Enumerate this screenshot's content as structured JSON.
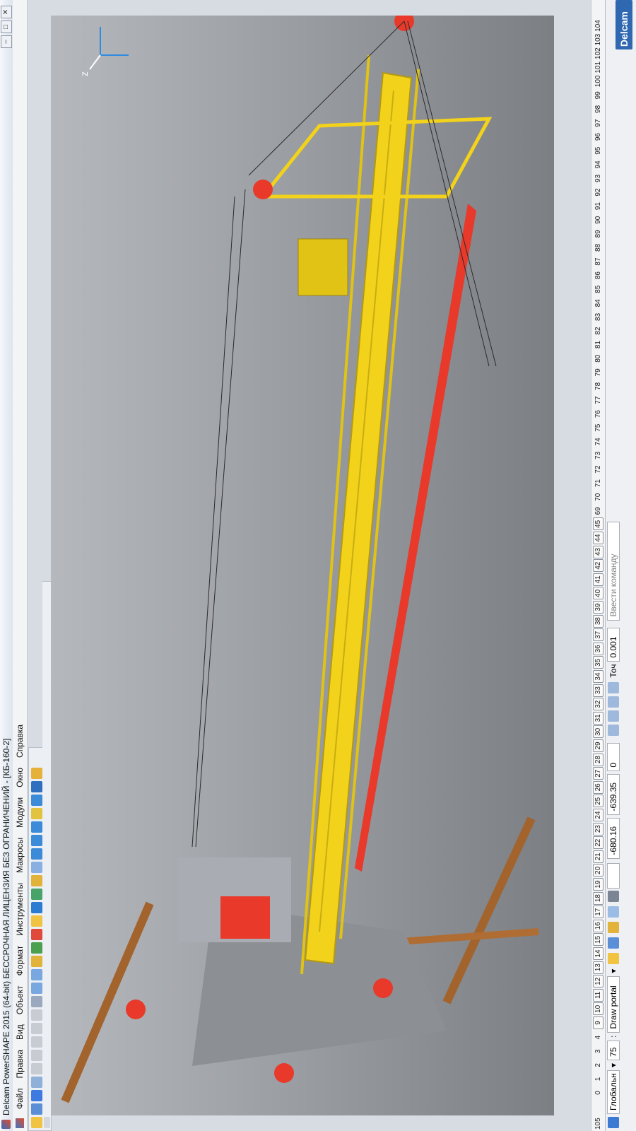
{
  "window": {
    "title": "Delcam PowerSHAPE 2015 (64-bit) БЕССРОЧНАЯ ЛИЦЕНЗИЯ БЕЗ ОГРАНИЧЕНИЙ - [КБ-160-2]",
    "min": "–",
    "max": "□",
    "close": "✕"
  },
  "menu": [
    "Файл",
    "Правка",
    "Вид",
    "Объект",
    "Формат",
    "Инструменты",
    "Макросы",
    "Модули",
    "Окно",
    "Справка"
  ],
  "viewport": {
    "axis_label": "z"
  },
  "ruler": {
    "start": "105",
    "levels": [
      "0",
      "1",
      "2",
      "3",
      "4",
      "9",
      "10",
      "11",
      "12",
      "13",
      "14",
      "15",
      "16",
      "17",
      "18",
      "19",
      "20",
      "21",
      "22",
      "23",
      "24",
      "25",
      "26",
      "27",
      "28",
      "29",
      "30",
      "31",
      "32",
      "33",
      "34",
      "35",
      "36",
      "37",
      "38",
      "39",
      "40",
      "41",
      "42",
      "43",
      "44",
      "45",
      "69",
      "70",
      "71",
      "72",
      "73",
      "74",
      "75",
      "76",
      "77",
      "78",
      "79",
      "80",
      "81",
      "82",
      "83",
      "84",
      "85",
      "86",
      "87",
      "88",
      "89",
      "90",
      "91",
      "92",
      "93",
      "94",
      "95",
      "96",
      "97",
      "98",
      "99",
      "100",
      "101",
      "102",
      "103",
      "104"
    ],
    "boxed_from": "9",
    "boxed_to": "45"
  },
  "status": {
    "workplane": "Глобальн",
    "level_number": "75",
    "level_name": "Draw portal",
    "x": "-680.16",
    "y": "-639.35",
    "z": "0",
    "tolerance_label": "Точ",
    "tolerance": "0.001",
    "command_placeholder": "Ввести команду",
    "brand": "Delcam"
  },
  "colors": {
    "crane_yellow": "#f2d21a",
    "crane_red": "#e8392b",
    "rail_brown": "#a2632c",
    "base_gray": "#8c8f94"
  }
}
